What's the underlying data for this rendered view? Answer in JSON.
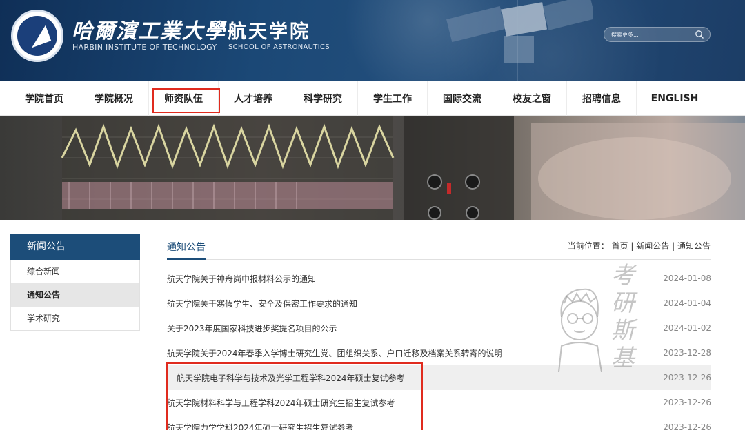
{
  "header": {
    "university_cn": "哈爾濱工業大學",
    "university_en": "HARBIN INSTITUTE OF TECHNOLOGY",
    "school_cn": "航天学院",
    "school_en": "SCHOOL OF ASTRONAUTICS",
    "search_placeholder": "搜索更多..."
  },
  "nav": {
    "items": [
      {
        "label": "学院首页"
      },
      {
        "label": "学院概况"
      },
      {
        "label": "师资队伍"
      },
      {
        "label": "人才培养"
      },
      {
        "label": "科学研究"
      },
      {
        "label": "学生工作"
      },
      {
        "label": "国际交流"
      },
      {
        "label": "校友之窗"
      },
      {
        "label": "招聘信息"
      },
      {
        "label": "ENGLISH"
      }
    ]
  },
  "sidebar": {
    "title": "新闻公告",
    "items": [
      {
        "label": "综合新闻"
      },
      {
        "label": "通知公告"
      },
      {
        "label": "学术研究"
      }
    ]
  },
  "main": {
    "title": "通知公告",
    "breadcrumb": {
      "prefix": "当前位置：",
      "home": "首页",
      "sep1": "|",
      "section": "新闻公告",
      "sep2": "|",
      "current": "通知公告"
    },
    "rows": [
      {
        "title": "航天学院关于神舟岗申报材料公示的通知",
        "date": "2024-01-08"
      },
      {
        "title": "航天学院关于寒假学生、安全及保密工作要求的通知",
        "date": "2024-01-04"
      },
      {
        "title": "关于2023年度国家科技进步奖提名项目的公示",
        "date": "2024-01-02"
      },
      {
        "title": "航天学院关于2024年春季入学博士研究生党、团组织关系、户口迁移及档案关系转寄的说明",
        "date": "2023-12-28"
      },
      {
        "title": "航天学院电子科学与技术及光学工程学科2024年硕士复试参考",
        "date": "2023-12-26"
      },
      {
        "title": "航天学院材料科学与工程学科2024年硕士研究生招生复试参考",
        "date": "2023-12-26"
      },
      {
        "title": "航天学院力学学科2024年硕士研究生招生复试参考",
        "date": "2023-12-26"
      }
    ]
  },
  "watermark": {
    "chars": [
      "考",
      "研",
      "斯",
      "基"
    ]
  },
  "colors": {
    "header_bg": "#1b4876",
    "accent": "#1c4d79",
    "highlight_red": "#e02b1e"
  }
}
